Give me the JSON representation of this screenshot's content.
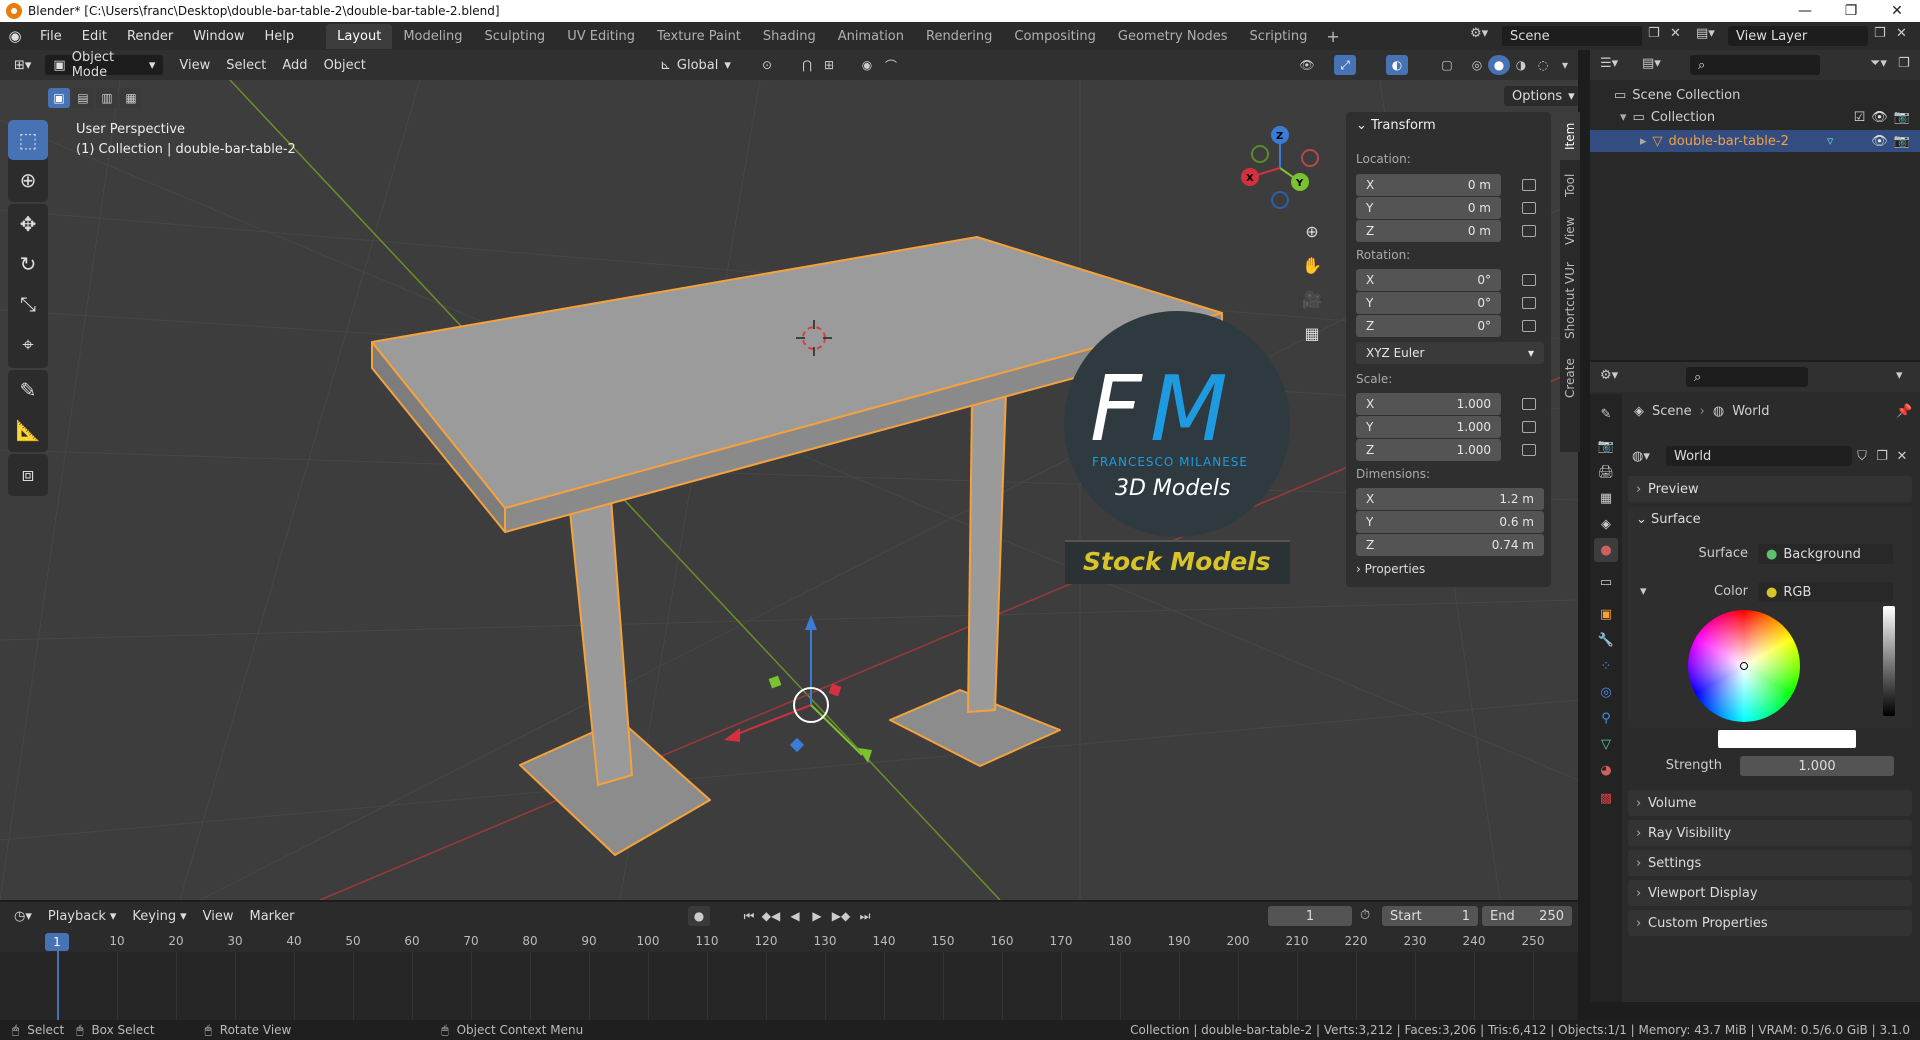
{
  "window": {
    "title": "Blender* [C:\\Users\\franc\\Desktop\\double-bar-table-2\\double-bar-table-2.blend]",
    "controls": [
      "—",
      "❐",
      "✕"
    ]
  },
  "menu": [
    "File",
    "Edit",
    "Render",
    "Window",
    "Help"
  ],
  "workspaces": [
    "Layout",
    "Modeling",
    "Sculpting",
    "UV Editing",
    "Texture Paint",
    "Shading",
    "Animation",
    "Rendering",
    "Compositing",
    "Geometry Nodes",
    "Scripting"
  ],
  "active_workspace": "Layout",
  "scene_name": "Scene",
  "view_layer": "View Layer",
  "viewport_header": {
    "mode": "Object Mode",
    "menus": [
      "View",
      "Select",
      "Add",
      "Object"
    ],
    "orientation": "Global",
    "options": "Options"
  },
  "viewport": {
    "perspective": "User Perspective",
    "collection_info": "(1) Collection | double-bar-table-2",
    "gizmo_axes": [
      "X",
      "Y",
      "Z"
    ]
  },
  "watermark": {
    "letters_f": "F",
    "letters_m": "M",
    "author": "FRANCESCO MILANESE",
    "subtitle": "3D Models",
    "banner": "Stock Models"
  },
  "npanel": {
    "tabs": [
      "Item",
      "Tool",
      "View",
      "Shortcut VUr",
      "Create"
    ],
    "transform_title": "Transform",
    "location_label": "Location:",
    "location": [
      {
        "axis": "X",
        "value": "0 m"
      },
      {
        "axis": "Y",
        "value": "0 m"
      },
      {
        "axis": "Z",
        "value": "0 m"
      }
    ],
    "rotation_label": "Rotation:",
    "rotation": [
      {
        "axis": "X",
        "value": "0°"
      },
      {
        "axis": "Y",
        "value": "0°"
      },
      {
        "axis": "Z",
        "value": "0°"
      }
    ],
    "rotation_mode": "XYZ Euler",
    "scale_label": "Scale:",
    "scale": [
      {
        "axis": "X",
        "value": "1.000"
      },
      {
        "axis": "Y",
        "value": "1.000"
      },
      {
        "axis": "Z",
        "value": "1.000"
      }
    ],
    "dimensions_label": "Dimensions:",
    "dimensions": [
      {
        "axis": "X",
        "value": "1.2 m"
      },
      {
        "axis": "Y",
        "value": "0.6 m"
      },
      {
        "axis": "Z",
        "value": "0.74 m"
      }
    ],
    "properties_label": "Properties"
  },
  "outliner": {
    "scene_collection": "Scene Collection",
    "collection": "Collection",
    "object": "double-bar-table-2"
  },
  "properties": {
    "breadcrumb_scene": "Scene",
    "breadcrumb_world": "World",
    "world_name": "World",
    "sections": [
      "Preview",
      "Surface",
      "Volume",
      "Ray Visibility",
      "Settings",
      "Viewport Display",
      "Custom Properties"
    ],
    "surface_label": "Surface",
    "surface_value": "Background",
    "color_label": "Color",
    "color_value": "RGB",
    "strength_label": "Strength",
    "strength_value": "1.000"
  },
  "timeline": {
    "menus": [
      "Playback",
      "Keying",
      "View",
      "Marker"
    ],
    "current_frame": "1",
    "start_label": "Start",
    "start": "1",
    "end_label": "End",
    "end": "250",
    "ticks": [
      "1",
      "10",
      "20",
      "30",
      "40",
      "50",
      "60",
      "70",
      "80",
      "90",
      "100",
      "110",
      "120",
      "130",
      "140",
      "150",
      "160",
      "170",
      "180",
      "190",
      "200",
      "210",
      "220",
      "230",
      "240",
      "250"
    ]
  },
  "statusbar": {
    "select": "Select",
    "box_select": "Box Select",
    "rotate_view": "Rotate View",
    "context_menu": "Object Context Menu",
    "stats": "Collection | double-bar-table-2 | Verts:3,212 | Faces:3,206 | Tris:6,412 | Objects:1/1 | Memory: 43.7 MiB | VRAM: 0.5/6.0 GiB | 3.1.0"
  },
  "colors": {
    "accent_blue": "#4772b3",
    "selection_orange": "#f5a13c",
    "axis_x": "#e0303f",
    "axis_y": "#7ac22f",
    "axis_z": "#2f6fd6"
  }
}
